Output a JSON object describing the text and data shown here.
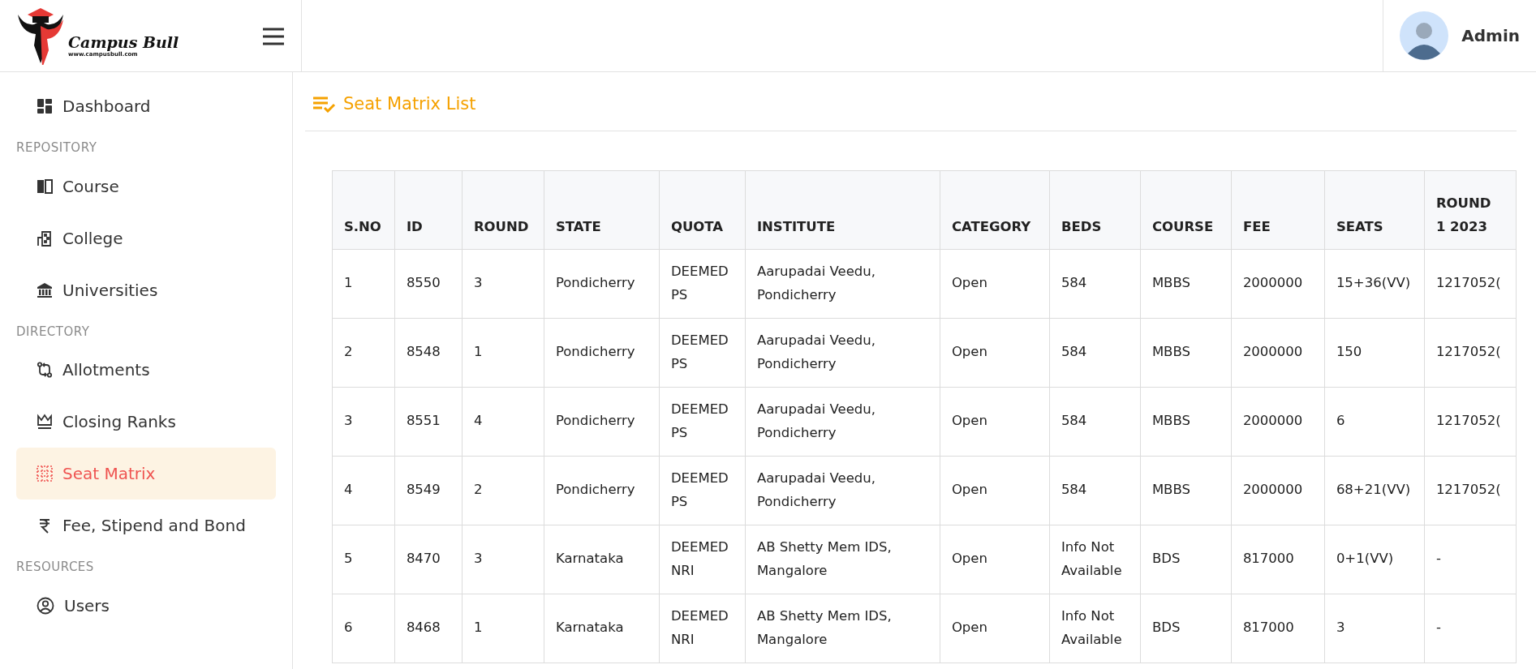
{
  "logo": {
    "name": "Campus Bull",
    "url": "www.campusbull.com"
  },
  "user": {
    "name": "Admin"
  },
  "sidebar": {
    "items": [
      {
        "kind": "link",
        "label": "Dashboard",
        "selected": false
      },
      {
        "kind": "heading",
        "label": "REPOSITORY"
      },
      {
        "kind": "link",
        "label": "Course",
        "selected": false
      },
      {
        "kind": "link",
        "label": "College",
        "selected": false
      },
      {
        "kind": "link",
        "label": "Universities",
        "selected": false
      },
      {
        "kind": "heading",
        "label": "DIRECTORY"
      },
      {
        "kind": "link",
        "label": "Allotments",
        "selected": false
      },
      {
        "kind": "link",
        "label": "Closing Ranks",
        "selected": false
      },
      {
        "kind": "link",
        "label": "Seat Matrix",
        "selected": true
      },
      {
        "kind": "link",
        "label": "Fee, Stipend and Bond",
        "selected": false
      },
      {
        "kind": "heading",
        "label": "RESOURCES"
      },
      {
        "kind": "link",
        "label": "Users",
        "selected": false
      }
    ]
  },
  "page": {
    "title": "Seat Matrix List"
  },
  "table": {
    "columns": [
      "S.NO",
      "ID",
      "ROUND",
      "STATE",
      "QUOTA",
      "INSTITUTE",
      "CATEGORY",
      "BEDS",
      "COURSE",
      "FEE",
      "SEATS",
      "ROUND 1 2023"
    ],
    "rows": [
      [
        "1",
        "8550",
        "3",
        "Pondicherry",
        "DEEMED PS",
        "Aarupadai Veedu, Pondicherry",
        "Open",
        "584",
        "MBBS",
        "2000000",
        "15+36(VV)",
        "1217052("
      ],
      [
        "2",
        "8548",
        "1",
        "Pondicherry",
        "DEEMED PS",
        "Aarupadai Veedu, Pondicherry",
        "Open",
        "584",
        "MBBS",
        "2000000",
        "150",
        "1217052("
      ],
      [
        "3",
        "8551",
        "4",
        "Pondicherry",
        "DEEMED PS",
        "Aarupadai Veedu, Pondicherry",
        "Open",
        "584",
        "MBBS",
        "2000000",
        "6",
        "1217052("
      ],
      [
        "4",
        "8549",
        "2",
        "Pondicherry",
        "DEEMED PS",
        "Aarupadai Veedu, Pondicherry",
        "Open",
        "584",
        "MBBS",
        "2000000",
        "68+21(VV)",
        "1217052("
      ],
      [
        "5",
        "8470",
        "3",
        "Karnataka",
        "DEEMED NRI",
        "AB Shetty Mem IDS, Mangalore",
        "Open",
        "Info Not Available",
        "BDS",
        "817000",
        "0+1(VV)",
        "-"
      ],
      [
        "6",
        "8468",
        "1",
        "Karnataka",
        "DEEMED NRI",
        "AB Shetty Mem IDS, Mangalore",
        "Open",
        "Info Not Available",
        "BDS",
        "817000",
        "3",
        "-"
      ]
    ]
  }
}
